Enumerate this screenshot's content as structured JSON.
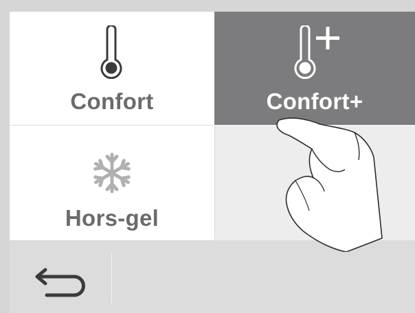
{
  "modes": {
    "confort": {
      "label": "Confort",
      "icon": "thermometer-icon"
    },
    "confort_plus": {
      "label": "Confort+",
      "icon": "thermometer-plus-icon",
      "selected": true
    },
    "hors_gel": {
      "label": "Hors-gel",
      "icon": "snowflake-icon"
    }
  },
  "bottom_bar": {
    "back_icon": "back-arrow-icon"
  },
  "colors": {
    "selected_tile": "#7c7c7e",
    "label_text": "#6b6b6b",
    "bottom_bar": "#dcdcdc",
    "empty_tile": "#ededed"
  }
}
